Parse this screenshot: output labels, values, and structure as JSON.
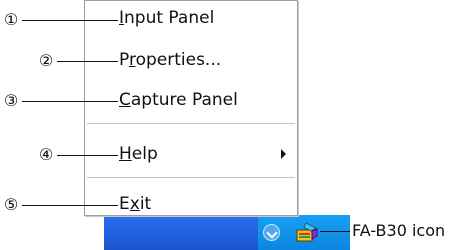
{
  "menu": {
    "items": [
      {
        "callout": "①",
        "pre": "",
        "mnemonic": "I",
        "post": "nput Panel",
        "has_submenu": false
      },
      {
        "callout": "②",
        "pre": "P",
        "mnemonic": "r",
        "post": "operties...",
        "has_submenu": false
      },
      {
        "callout": "③",
        "pre": "",
        "mnemonic": "C",
        "post": "apture Panel",
        "has_submenu": false
      },
      {
        "callout": "④",
        "pre": "",
        "mnemonic": "H",
        "post": "elp",
        "has_submenu": true
      },
      {
        "callout": "⑤",
        "pre": "E",
        "mnemonic": "x",
        "post": "it",
        "has_submenu": false
      }
    ]
  },
  "tray": {
    "icon_label": "FA-B30 icon",
    "icon_name": "fa-b30-icon",
    "chevron_icon": "chevron-down-icon"
  },
  "colors": {
    "taskbar": "#1d5bd6",
    "systray": "#0d8ee8",
    "menu_bg": "#ffffff",
    "menu_border": "#9d9d9d"
  }
}
